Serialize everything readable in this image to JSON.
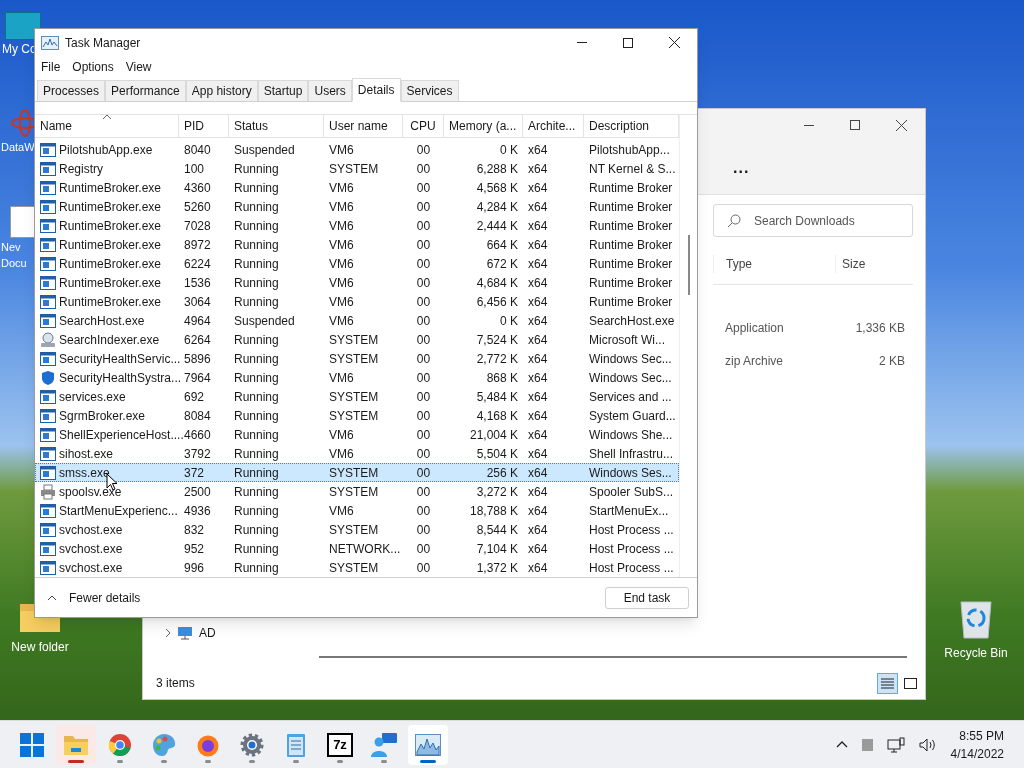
{
  "desktop_icons": [
    {
      "kind": "monitor",
      "lines": [
        "My Co"
      ]
    },
    {
      "kind": "atom",
      "lines": [
        "DataW"
      ]
    },
    {
      "kind": "document",
      "lines": [
        "Nev",
        "Docu"
      ]
    },
    {
      "kind": "folder",
      "lines": [
        "New folder"
      ]
    },
    {
      "kind": "recycle",
      "lines": [
        "Recycle Bin"
      ]
    }
  ],
  "explorer": {
    "more": "...",
    "search": {
      "placeholder": "Search Downloads"
    },
    "columns": [
      "Type",
      "Size"
    ],
    "rows": [
      {
        "type": "Application",
        "size": "1,336 KB"
      },
      {
        "type": "zip Archive",
        "size": "2 KB"
      }
    ],
    "nav_item": "AD",
    "status": "3 items",
    "views": [
      {
        "kind": "details",
        "selected": true
      },
      {
        "kind": "tiles",
        "selected": false
      }
    ]
  },
  "task_manager": {
    "title": "Task Manager",
    "menu": [
      "File",
      "Options",
      "View"
    ],
    "tabs": [
      {
        "label": "Processes",
        "selected": false
      },
      {
        "label": "Performance",
        "selected": false
      },
      {
        "label": "App history",
        "selected": false
      },
      {
        "label": "Startup",
        "selected": false
      },
      {
        "label": "Users",
        "selected": false
      },
      {
        "label": "Details",
        "selected": true
      },
      {
        "label": "Services",
        "selected": false
      }
    ],
    "columns": [
      "Name",
      "PID",
      "Status",
      "User name",
      "CPU",
      "Memory (a...",
      "Archite...",
      "Description"
    ],
    "rows": [
      {
        "kind": "app",
        "cells": [
          "PilotshubApp.exe",
          "8040",
          "Suspended",
          "VM6",
          "00",
          "0 K",
          "x64",
          "PilotshubApp..."
        ],
        "selected": false
      },
      {
        "kind": "app",
        "cells": [
          "Registry",
          "100",
          "Running",
          "SYSTEM",
          "00",
          "6,288 K",
          "x64",
          "NT Kernel & S..."
        ],
        "selected": false
      },
      {
        "kind": "app",
        "cells": [
          "RuntimeBroker.exe",
          "4360",
          "Running",
          "VM6",
          "00",
          "4,568 K",
          "x64",
          "Runtime Broker"
        ],
        "selected": false
      },
      {
        "kind": "app",
        "cells": [
          "RuntimeBroker.exe",
          "5260",
          "Running",
          "VM6",
          "00",
          "4,284 K",
          "x64",
          "Runtime Broker"
        ],
        "selected": false
      },
      {
        "kind": "app",
        "cells": [
          "RuntimeBroker.exe",
          "7028",
          "Running",
          "VM6",
          "00",
          "2,444 K",
          "x64",
          "Runtime Broker"
        ],
        "selected": false
      },
      {
        "kind": "app",
        "cells": [
          "RuntimeBroker.exe",
          "8972",
          "Running",
          "VM6",
          "00",
          "664 K",
          "x64",
          "Runtime Broker"
        ],
        "selected": false
      },
      {
        "kind": "app",
        "cells": [
          "RuntimeBroker.exe",
          "6224",
          "Running",
          "VM6",
          "00",
          "672 K",
          "x64",
          "Runtime Broker"
        ],
        "selected": false
      },
      {
        "kind": "app",
        "cells": [
          "RuntimeBroker.exe",
          "1536",
          "Running",
          "VM6",
          "00",
          "4,684 K",
          "x64",
          "Runtime Broker"
        ],
        "selected": false
      },
      {
        "kind": "app",
        "cells": [
          "RuntimeBroker.exe",
          "3064",
          "Running",
          "VM6",
          "00",
          "6,456 K",
          "x64",
          "Runtime Broker"
        ],
        "selected": false
      },
      {
        "kind": "app",
        "cells": [
          "SearchHost.exe",
          "4964",
          "Suspended",
          "VM6",
          "00",
          "0 K",
          "x64",
          "SearchHost.exe"
        ],
        "selected": false
      },
      {
        "kind": "search",
        "cells": [
          "SearchIndexer.exe",
          "6264",
          "Running",
          "SYSTEM",
          "00",
          "7,524 K",
          "x64",
          "Microsoft Wi..."
        ],
        "selected": false
      },
      {
        "kind": "app",
        "cells": [
          "SecurityHealthServic...",
          "5896",
          "Running",
          "SYSTEM",
          "00",
          "2,772 K",
          "x64",
          "Windows Sec..."
        ],
        "selected": false
      },
      {
        "kind": "shield",
        "cells": [
          "SecurityHealthSystra...",
          "7964",
          "Running",
          "VM6",
          "00",
          "868 K",
          "x64",
          "Windows Sec..."
        ],
        "selected": false
      },
      {
        "kind": "app",
        "cells": [
          "services.exe",
          "692",
          "Running",
          "SYSTEM",
          "00",
          "5,484 K",
          "x64",
          "Services and ..."
        ],
        "selected": false
      },
      {
        "kind": "app",
        "cells": [
          "SgrmBroker.exe",
          "8084",
          "Running",
          "SYSTEM",
          "00",
          "4,168 K",
          "x64",
          "System Guard..."
        ],
        "selected": false
      },
      {
        "kind": "app",
        "cells": [
          "ShellExperienceHost....",
          "4660",
          "Running",
          "VM6",
          "00",
          "21,004 K",
          "x64",
          "Windows She..."
        ],
        "selected": false
      },
      {
        "kind": "app",
        "cells": [
          "sihost.exe",
          "3792",
          "Running",
          "VM6",
          "00",
          "5,504 K",
          "x64",
          "Shell Infrastru..."
        ],
        "selected": false
      },
      {
        "kind": "app",
        "cells": [
          "smss.exe",
          "372",
          "Running",
          "SYSTEM",
          "00",
          "256 K",
          "x64",
          "Windows Ses..."
        ],
        "selected": true
      },
      {
        "kind": "printer",
        "cells": [
          "spoolsv.exe",
          "2500",
          "Running",
          "SYSTEM",
          "00",
          "3,272 K",
          "x64",
          "Spooler SubS..."
        ],
        "selected": false
      },
      {
        "kind": "app",
        "cells": [
          "StartMenuExperienc...",
          "4936",
          "Running",
          "VM6",
          "00",
          "18,788 K",
          "x64",
          "StartMenuEx..."
        ],
        "selected": false
      },
      {
        "kind": "app",
        "cells": [
          "svchost.exe",
          "832",
          "Running",
          "SYSTEM",
          "00",
          "8,544 K",
          "x64",
          "Host Process ..."
        ],
        "selected": false
      },
      {
        "kind": "app",
        "cells": [
          "svchost.exe",
          "952",
          "Running",
          "NETWORK...",
          "00",
          "7,104 K",
          "x64",
          "Host Process ..."
        ],
        "selected": false
      },
      {
        "kind": "app",
        "cells": [
          "svchost.exe",
          "996",
          "Running",
          "SYSTEM",
          "00",
          "1,372 K",
          "x64",
          "Host Process ..."
        ],
        "selected": false
      }
    ],
    "fewer_details": "Fewer details",
    "end_task": "End task"
  },
  "taskbar": {
    "apps": [
      {
        "kind": "start",
        "running": false,
        "active": false,
        "attention": false
      },
      {
        "kind": "folder",
        "running": true,
        "active": false,
        "attention": true
      },
      {
        "kind": "browser",
        "running": true,
        "active": false,
        "attention": false
      },
      {
        "kind": "palette",
        "running": true,
        "active": false,
        "attention": false
      },
      {
        "kind": "flame",
        "running": true,
        "active": false,
        "attention": false
      },
      {
        "kind": "gear",
        "running": true,
        "active": false,
        "attention": false
      },
      {
        "kind": "notepad",
        "running": true,
        "active": false,
        "attention": false
      },
      {
        "kind": "archive",
        "label": "7z",
        "running": true,
        "active": false,
        "attention": false
      },
      {
        "kind": "chat",
        "running": true,
        "active": false,
        "attention": false
      },
      {
        "kind": "chart",
        "running": true,
        "active": true,
        "attention": false
      }
    ],
    "time": "8:55 PM",
    "date": "4/14/2022"
  }
}
